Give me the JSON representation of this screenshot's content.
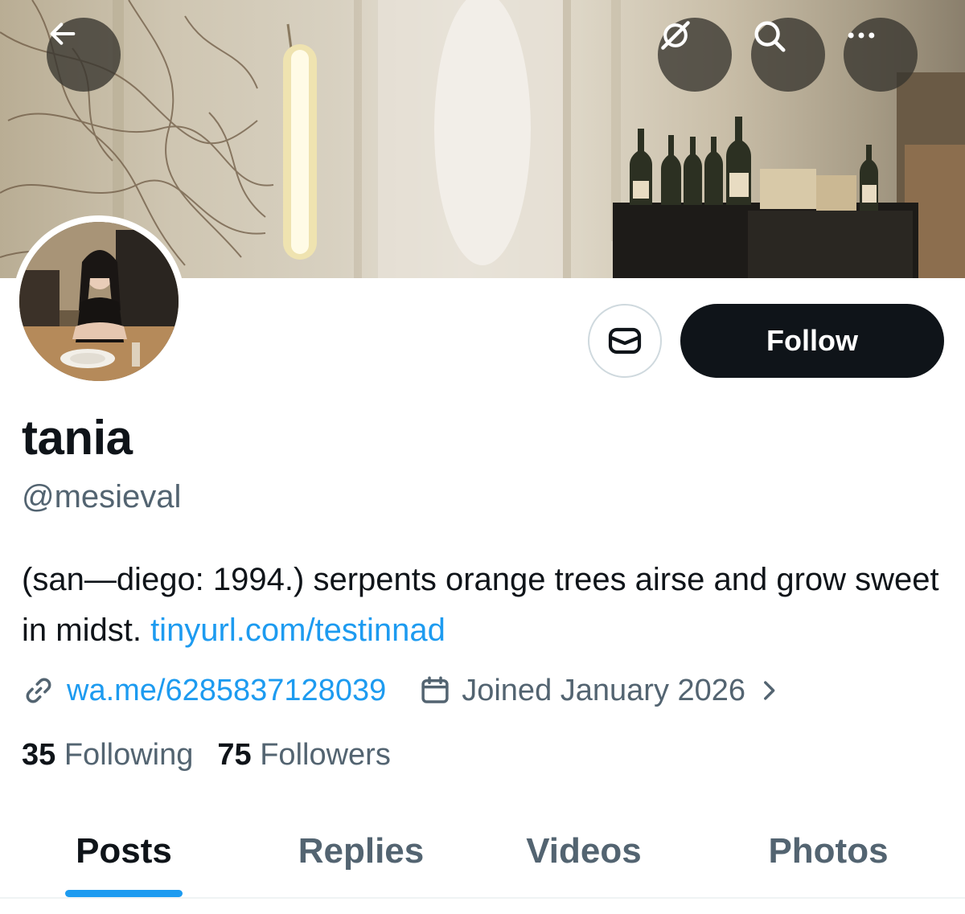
{
  "header": {
    "back_icon": "arrow-left-icon",
    "grok_icon": "slashed-circle-icon",
    "search_icon": "search-icon",
    "more_icon": "more-horizontal-icon",
    "button_bg": "#37342e"
  },
  "profile": {
    "display_name": "tania",
    "handle": "@mesieval",
    "bio_text": "(san—diego: 1994.) serpents orange trees airse and grow sweet in midst.",
    "bio_link": "tinyurl.com/testinnad",
    "website": "wa.me/6285837128039",
    "joined": "Joined January 2026",
    "following_count": "35",
    "following_label": "Following",
    "followers_count": "75",
    "followers_label": "Followers"
  },
  "actions": {
    "message_icon": "envelope-icon",
    "follow_label": "Follow"
  },
  "tabs": [
    {
      "label": "Posts",
      "active": true
    },
    {
      "label": "Replies",
      "active": false
    },
    {
      "label": "Videos",
      "active": false
    },
    {
      "label": "Photos",
      "active": false
    }
  ],
  "colors": {
    "accent": "#1d9bf0",
    "text": "#0f1419",
    "secondary": "#536471",
    "follow_bg": "#0f1419"
  }
}
